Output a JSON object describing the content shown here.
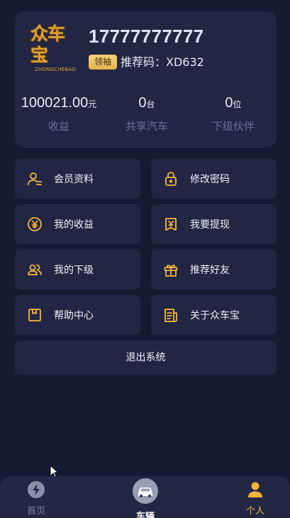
{
  "profile": {
    "logo_text": "众车宝",
    "logo_sub": "ZHONGCHEBAO",
    "phone": "17777777777",
    "level_badge": "领袖",
    "referral": "推荐码：XD632"
  },
  "stats": [
    {
      "value": "100021.00",
      "unit": "元",
      "label": "收益"
    },
    {
      "value": "0",
      "unit": "台",
      "label": "共享汽车"
    },
    {
      "value": "0",
      "unit": "位",
      "label": "下级伙伴"
    }
  ],
  "menu": [
    {
      "label": "会员资料",
      "icon": "member-info-icon"
    },
    {
      "label": "修改密码",
      "icon": "lock-icon"
    },
    {
      "label": "我的收益",
      "icon": "yen-coin-icon"
    },
    {
      "label": "我要提现",
      "icon": "withdraw-icon"
    },
    {
      "label": "我的下级",
      "icon": "team-icon"
    },
    {
      "label": "推荐好友",
      "icon": "gift-icon"
    },
    {
      "label": "帮助中心",
      "icon": "help-book-icon"
    },
    {
      "label": "关于众车宝",
      "icon": "document-icon"
    }
  ],
  "logout_label": "退出系统",
  "tabs": [
    {
      "label": "首页",
      "icon": "lightning-icon"
    },
    {
      "label": "车辆",
      "icon": "car-icon"
    },
    {
      "label": "个人",
      "icon": "person-icon"
    }
  ],
  "colors": {
    "background": "#171a33",
    "card": "#222643",
    "accent": "#f2b63b",
    "muted": "#6d7193"
  }
}
